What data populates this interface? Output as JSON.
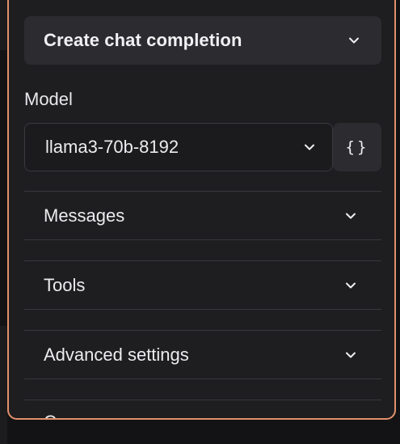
{
  "action": {
    "title": "Create chat completion"
  },
  "model": {
    "label": "Model",
    "value": "llama3-70b-8192",
    "json_button_label": "{}"
  },
  "sections": [
    {
      "label": "Messages"
    },
    {
      "label": "Tools"
    },
    {
      "label": "Advanced settings"
    },
    {
      "label": "Co"
    }
  ],
  "icons": {
    "dropdown": "chevron-down-icon",
    "json": "braces-icon"
  },
  "colors": {
    "panel_border": "#e1916a",
    "panel_background": "#1e1d20",
    "page_background": "#131315",
    "button_background": "#2c2b2f",
    "text": "#ececef"
  }
}
